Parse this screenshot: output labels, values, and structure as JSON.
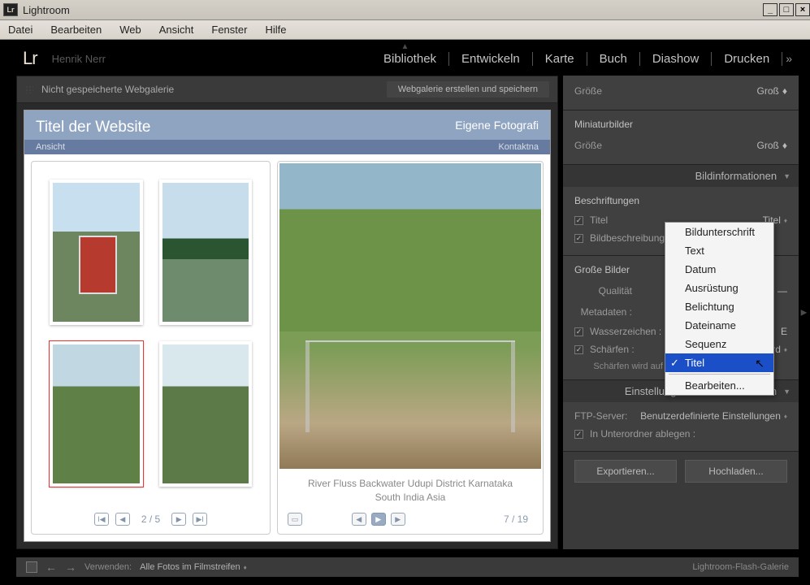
{
  "window": {
    "title": "Lightroom"
  },
  "menu": {
    "file": "Datei",
    "edit": "Bearbeiten",
    "web": "Web",
    "view": "Ansicht",
    "window": "Fenster",
    "help": "Hilfe"
  },
  "header": {
    "logo": "Lr",
    "user": "Henrik Nerr",
    "modules": {
      "library": "Bibliothek",
      "develop": "Entwickeln",
      "map": "Karte",
      "book": "Buch",
      "slideshow": "Diashow",
      "print": "Drucken"
    }
  },
  "preview": {
    "unsaved": "Nicht gespeicherte Webgalerie",
    "create_save": "Webgalerie erstellen und speichern",
    "site": {
      "title": "Titel der Website",
      "subtitle": "Eigene Fotografi",
      "nav_left": "Ansicht",
      "nav_right": "Kontaktna",
      "thumb_page": "2 / 5",
      "caption1": "River Fluss Backwater Udupi District Karnataka",
      "caption2": "South India Asia",
      "large_page": "7 / 19"
    }
  },
  "panels": {
    "size_label": "Größe",
    "size_value": "Groß",
    "mini_header": "Miniaturbilder",
    "info_header": "Bildinformationen",
    "captions_label": "Beschriftungen",
    "title_label": "Titel",
    "title_value": "Titel",
    "descr_label": "Bildbeschreibung",
    "large_header": "Große Bilder",
    "quality_label": "Qualität",
    "metadata_label": "Metadaten :",
    "watermark_label": "Wasserzeichen :",
    "watermark_value": "E",
    "sharpen_label": "Schärfen :",
    "sharpen_value": "Standard",
    "sharpen_note": "Schärfen wird auf die Ausgabe angewendet.",
    "upload_header": "Einstellungen für das Hochladen",
    "ftp_label": "FTP-Server:",
    "ftp_value": "Benutzerdefinierte Einstellungen",
    "subfolder_label": "In Unterordner ablegen :",
    "export_btn": "Exportieren...",
    "upload_btn": "Hochladen..."
  },
  "dropdown": {
    "items": [
      "Bilduntersch­rift",
      "Text",
      "Datum",
      "Ausrüstung",
      "Belichtung",
      "Dateiname",
      "Sequenz",
      "Titel"
    ],
    "i0": "Bildunterschrift",
    "i1": "Text",
    "i2": "Datum",
    "i3": "Ausrüstung",
    "i4": "Belichtung",
    "i5": "Dateiname",
    "i6": "Sequenz",
    "i7": "Titel",
    "edit": "Bearbeiten..."
  },
  "bottom": {
    "use_label": "Verwenden:",
    "use_value": "Alle Fotos im Filmstreifen",
    "gallery": "Lightroom-Flash-Galerie"
  }
}
